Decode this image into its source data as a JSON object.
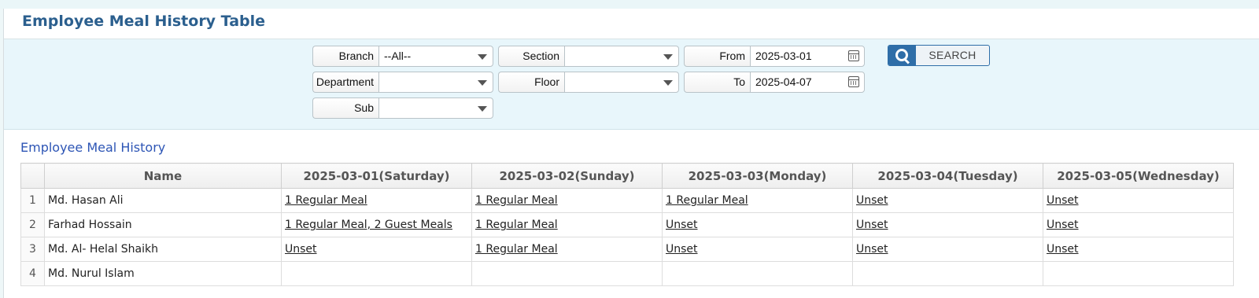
{
  "page": {
    "title": "Employee Meal History Table"
  },
  "filters": {
    "branch": {
      "label": "Branch",
      "value": "--All--"
    },
    "section": {
      "label": "Section",
      "value": ""
    },
    "from": {
      "label": "From",
      "value": "2025-03-01"
    },
    "department": {
      "label": "Department",
      "value": ""
    },
    "floor": {
      "label": "Floor",
      "value": ""
    },
    "to": {
      "label": "To",
      "value": "2025-04-07"
    },
    "sub": {
      "label": "Sub",
      "value": ""
    },
    "search_label": "SEARCH"
  },
  "history": {
    "title": "Employee Meal History",
    "columns": [
      "",
      "Name",
      "2025-03-01(Saturday)",
      "2025-03-02(Sunday)",
      "2025-03-03(Monday)",
      "2025-03-04(Tuesday)",
      "2025-03-05(Wednesday)"
    ],
    "rows": [
      {
        "num": "1",
        "name": "Md. Hasan Ali",
        "cells": [
          "1 Regular Meal",
          "1 Regular Meal",
          "1 Regular Meal",
          "Unset",
          "Unset"
        ]
      },
      {
        "num": "2",
        "name": "Farhad Hossain",
        "cells": [
          "1 Regular Meal, 2 Guest Meals",
          "1 Regular Meal",
          "Unset",
          "Unset",
          "Unset"
        ]
      },
      {
        "num": "3",
        "name": "Md. Al- Helal Shaikh",
        "cells": [
          "Unset",
          "1 Regular Meal",
          "Unset",
          "Unset",
          "Unset"
        ]
      },
      {
        "num": "4",
        "name": "Md. Nurul Islam",
        "cells": [
          "",
          "",
          "",
          "",
          ""
        ]
      }
    ]
  }
}
